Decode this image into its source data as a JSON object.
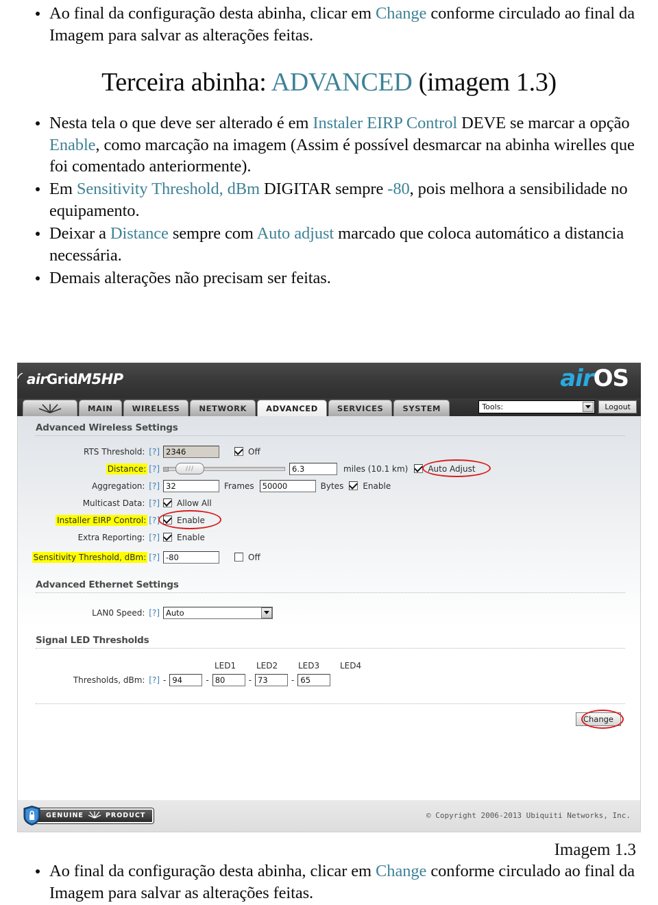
{
  "document": {
    "top_bullets": [
      {
        "segments": [
          {
            "t": "Ao final da configuração desta abinha, clicar em ",
            "hl": false
          },
          {
            "t": "Change",
            "hl": true
          },
          {
            "t": " conforme circulado ao final da Imagem para salvar as alterações feitas.",
            "hl": false
          }
        ]
      }
    ],
    "section_title": {
      "before": "Terceira abinha: ",
      "highlight": "ADVANCED",
      "after": " (imagem 1.3)"
    },
    "mid_bullets": [
      {
        "segments": [
          {
            "t": "Nesta tela o que deve ser alterado é em ",
            "hl": false
          },
          {
            "t": "Instaler EIRP Control",
            "hl": true
          },
          {
            "t": " DEVE se marcar a opção ",
            "hl": false
          },
          {
            "t": "Enable",
            "hl": true
          },
          {
            "t": ", como marcação na imagem (Assim é possível desmarcar na abinha wirelles que foi comentado anteriormente).",
            "hl": false
          }
        ]
      },
      {
        "segments": [
          {
            "t": "Em ",
            "hl": false
          },
          {
            "t": "Sensitivity Threshold, dBm",
            "hl": true
          },
          {
            "t": " DIGITAR sempre ",
            "hl": false
          },
          {
            "t": "-80",
            "hl": true
          },
          {
            "t": ", pois melhora a sensibilidade no equipamento.",
            "hl": false
          }
        ]
      },
      {
        "segments": [
          {
            "t": "Deixar a ",
            "hl": false
          },
          {
            "t": "Distance",
            "hl": true
          },
          {
            "t": " sempre com ",
            "hl": false
          },
          {
            "t": "Auto adjust",
            "hl": true
          },
          {
            "t": " marcado que coloca automático a distancia necessária.",
            "hl": false
          }
        ]
      },
      {
        "segments": [
          {
            "t": "Demais alterações não precisam ser feitas.",
            "hl": false
          }
        ]
      }
    ],
    "caption": "Imagem 1.3",
    "bottom_bullets": [
      {
        "segments": [
          {
            "t": "Ao final da configuração desta abinha, clicar em ",
            "hl": false
          },
          {
            "t": "Change",
            "hl": true
          },
          {
            "t": " conforme circulado ao final da Imagem para salvar as alterações feitas.",
            "hl": false
          }
        ]
      }
    ],
    "accent_color": "#3e8296"
  },
  "airos": {
    "brand": {
      "product_air": "air",
      "product_grid": "Grid",
      "product_model": "M5HP",
      "os_air": "air",
      "os_name": "OS"
    },
    "tabs": [
      {
        "label": "",
        "name": "tab-home",
        "active": false,
        "icon": "ubiquiti-antenna-icon"
      },
      {
        "label": "MAIN",
        "name": "tab-main",
        "active": false
      },
      {
        "label": "WIRELESS",
        "name": "tab-wireless",
        "active": false
      },
      {
        "label": "NETWORK",
        "name": "tab-network",
        "active": false
      },
      {
        "label": "ADVANCED",
        "name": "tab-advanced",
        "active": true
      },
      {
        "label": "SERVICES",
        "name": "tab-services",
        "active": false
      },
      {
        "label": "SYSTEM",
        "name": "tab-system",
        "active": false
      }
    ],
    "tools": {
      "value": "Tools:",
      "logout_label": "Logout"
    },
    "sections": {
      "wireless_title": "Advanced Wireless Settings",
      "ethernet_title": "Advanced Ethernet Settings",
      "led_title": "Signal LED Thresholds"
    },
    "fields": {
      "rts": {
        "label": "RTS Threshold:",
        "help": "[?]",
        "value": "2346",
        "checkbox_label": "Off",
        "checked": true
      },
      "distance": {
        "label": "Distance:",
        "help": "[?]",
        "highlighted": true,
        "value": "6.3",
        "unit": "miles (10.1 km)",
        "checkbox_label": "Auto Adjust",
        "checked": true,
        "circled": true
      },
      "aggregation": {
        "label": "Aggregation:",
        "help": "[?]",
        "frames_value": "32",
        "frames_label": "Frames",
        "bytes_value": "50000",
        "bytes_label": "Bytes",
        "checkbox_label": "Enable",
        "checked": true
      },
      "multicast": {
        "label": "Multicast Data:",
        "help": "[?]",
        "checkbox_label": "Allow All",
        "checked": true
      },
      "eirp": {
        "label": "Installer EIRP Control:",
        "help": "[?]",
        "highlighted": true,
        "checkbox_label": "Enable",
        "checked": true,
        "circled": true
      },
      "extra_reporting": {
        "label": "Extra Reporting:",
        "help": "[?]",
        "checkbox_label": "Enable",
        "checked": true
      },
      "sensitivity": {
        "label": "Sensitivity Threshold, dBm:",
        "help": "[?]",
        "highlighted": true,
        "value": "-80",
        "checkbox_label": "Off",
        "checked": false
      },
      "lan0": {
        "label": "LAN0 Speed:",
        "help": "[?]",
        "value": "Auto"
      },
      "led_thresholds": {
        "label": "Thresholds, dBm:",
        "help": "[?]",
        "headers": [
          "LED1",
          "LED2",
          "LED3",
          "LED4"
        ],
        "values": [
          "94",
          "80",
          "73",
          "65"
        ],
        "separator": "-"
      }
    },
    "change_button": {
      "label": "Change",
      "circled": true
    },
    "footer": {
      "genuine_left": "GENUINE",
      "genuine_right": "PRODUCT",
      "copyright": "© Copyright 2006-2013 Ubiquiti Networks, Inc."
    },
    "highlight_color": "#ffff00",
    "annotation_color": "#d81f20"
  }
}
